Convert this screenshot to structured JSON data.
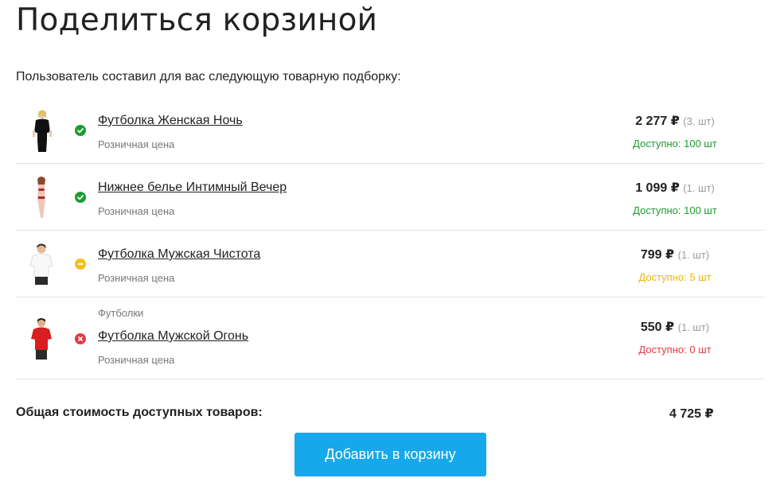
{
  "page": {
    "title": "Поделиться корзиной",
    "intro": "Пользователь составил для вас следующую товарную подборку:"
  },
  "items": [
    {
      "name": "Футболка Женская Ночь",
      "category": "",
      "price_type": "Розничная цена",
      "price": "2 277 ₽",
      "qty": "(3. шт)",
      "availability": "Доступно: 100 шт",
      "status": "ok",
      "icon": "check-icon",
      "thumb": "woman-black-tshirt"
    },
    {
      "name": "Нижнее белье Интимный Вечер",
      "category": "",
      "price_type": "Розничная цена",
      "price": "1 099 ₽",
      "qty": "(1. шт)",
      "availability": "Доступно: 100 шт",
      "status": "ok",
      "icon": "check-icon",
      "thumb": "woman-lingerie"
    },
    {
      "name": "Футболка Мужская Чистота",
      "category": "",
      "price_type": "Розничная цена",
      "price": "799 ₽",
      "qty": "(1. шт)",
      "availability": "Доступно: 5 шт",
      "status": "warn",
      "icon": "minus-icon",
      "thumb": "man-white-tshirt"
    },
    {
      "name": "Футболка Мужской Огонь",
      "category": "Футболки",
      "price_type": "Розничная цена",
      "price": "550 ₽",
      "qty": "(1. шт)",
      "availability": "Доступно: 0 шт",
      "status": "bad",
      "icon": "cross-icon",
      "thumb": "man-red-tshirt"
    }
  ],
  "total": {
    "label": "Общая стоимость доступных товаров:",
    "value": "4 725 ₽"
  },
  "actions": {
    "add_to_cart": "Добавить в корзину"
  },
  "colors": {
    "ok": "#1e9b2e",
    "warn": "#f3c01a",
    "bad": "#e23a45",
    "button": "#15a8ea"
  }
}
